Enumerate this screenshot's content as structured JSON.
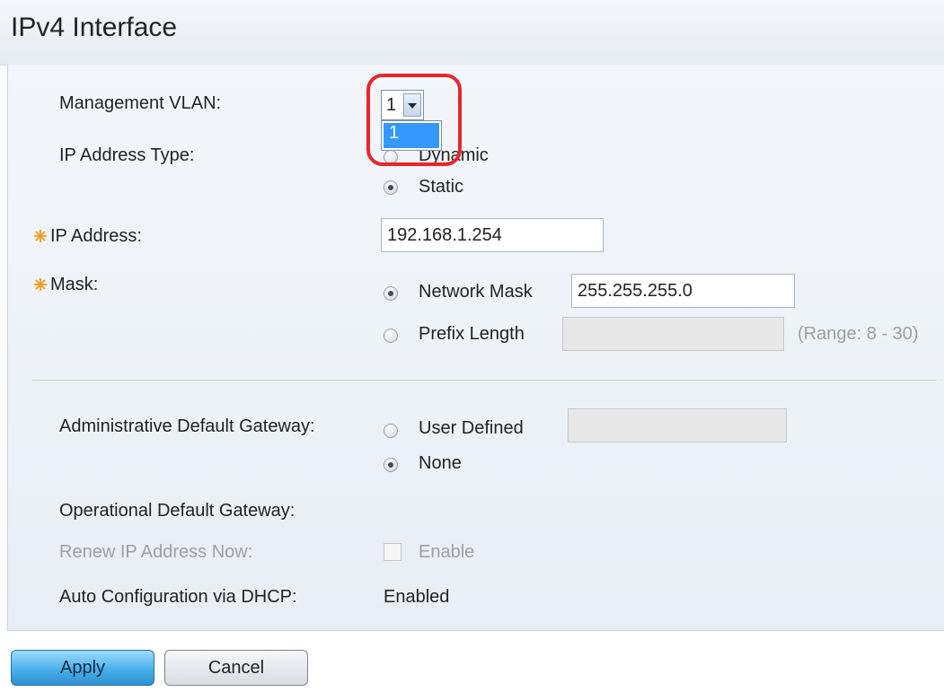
{
  "header": {
    "title": "IPv4 Interface"
  },
  "form": {
    "management_vlan": {
      "label": "Management VLAN:",
      "selected": "1",
      "dropdown_option": "1"
    },
    "ip_address_type": {
      "label": "IP Address Type:",
      "option_dynamic": "Dynamic",
      "option_static": "Static",
      "selected": "Static"
    },
    "ip_address": {
      "label": "IP Address:",
      "value": "192.168.1.254"
    },
    "mask": {
      "label": "Mask:",
      "option_network_mask": "Network Mask",
      "network_mask_value": "255.255.255.0",
      "option_prefix_length": "Prefix Length",
      "prefix_length_value": "",
      "prefix_range": "(Range: 8 - 30)",
      "selected": "Network Mask"
    },
    "admin_default_gateway": {
      "label": "Administrative Default Gateway:",
      "option_user_defined": "User Defined",
      "user_defined_value": "",
      "option_none": "None",
      "selected": "None"
    },
    "operational_default_gateway": {
      "label": "Operational Default Gateway:"
    },
    "renew_ip": {
      "label": "Renew IP Address Now:",
      "checkbox_label": "Enable"
    },
    "auto_config_dhcp": {
      "label": "Auto Configuration via DHCP:",
      "value": "Enabled"
    }
  },
  "buttons": {
    "apply": "Apply",
    "cancel": "Cancel"
  },
  "colors": {
    "highlight": "#e8262b",
    "required_star": "#f0a020",
    "selection": "#3399ff"
  },
  "icons": {
    "required": "required-star-icon",
    "dropdown": "chevron-down-icon"
  }
}
